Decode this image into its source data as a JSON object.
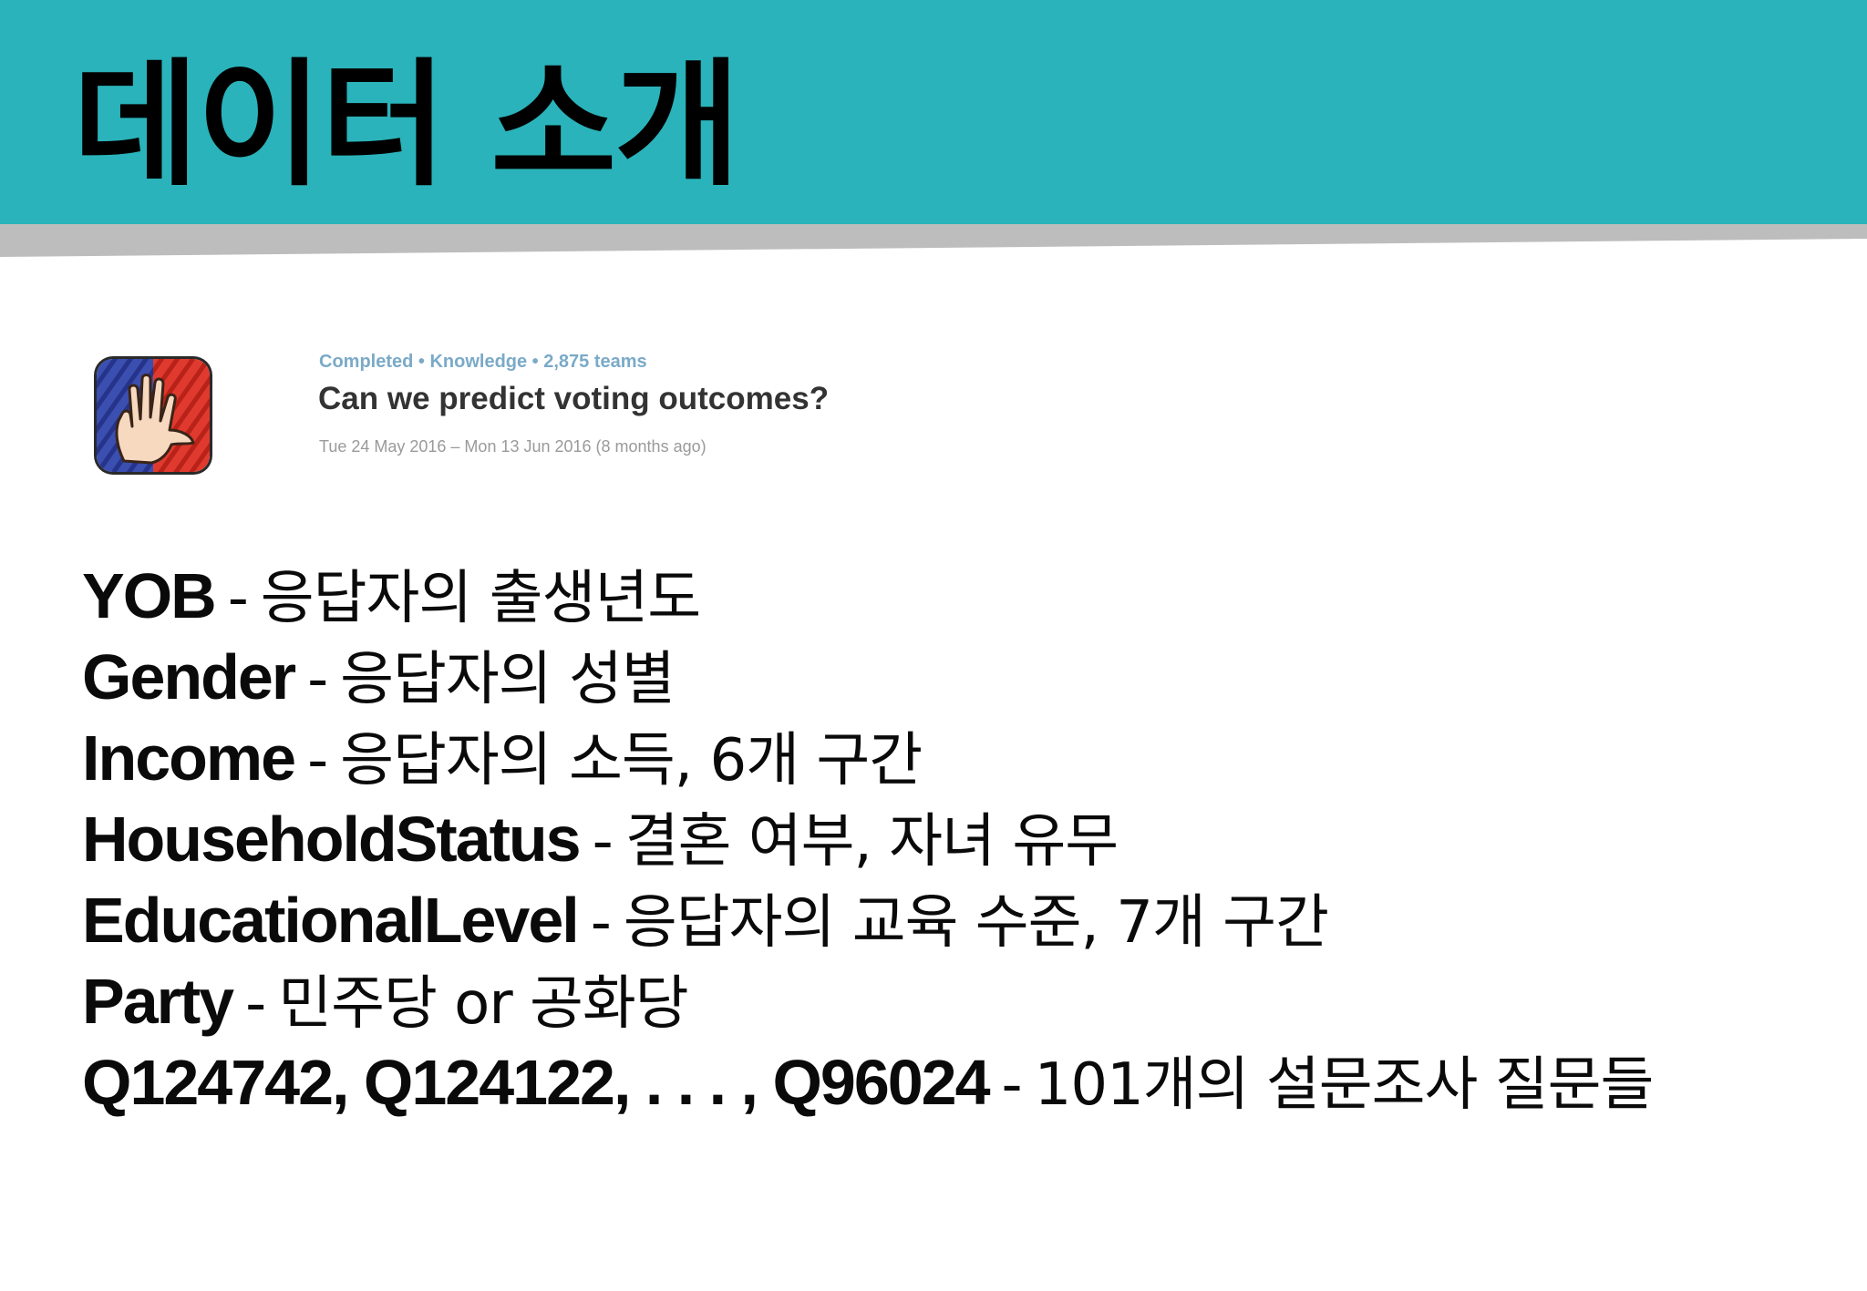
{
  "slide": {
    "title": "데이터 소개",
    "colors": {
      "header": "#2ab3ba",
      "header_shadow": "#bdbdbd",
      "meta_text": "#7aaac8"
    }
  },
  "competition": {
    "logo_icon": "raised-hand-flag-icon",
    "meta": "Completed • Knowledge • 2,875 teams",
    "title": "Can we predict voting outcomes?",
    "dates": "Tue 24 May 2016 – Mon 13 Jun 2016 (8 months ago)"
  },
  "variables": [
    {
      "name": "YOB",
      "sep": "-",
      "desc": "응답자의 출생년도"
    },
    {
      "name": "Gender",
      "sep": "-",
      "desc": "응답자의 성별"
    },
    {
      "name": "Income",
      "sep": "-",
      "desc": "응답자의 소득, 6개 구간"
    },
    {
      "name": "HouseholdStatus",
      "sep": "-",
      "desc": "결혼 여부, 자녀 유무"
    },
    {
      "name": "EducationalLevel",
      "sep": "-",
      "desc": "응답자의 교육 수준, 7개 구간"
    },
    {
      "name": "Party",
      "sep": "-",
      "desc": "민주당 or 공화당"
    },
    {
      "name": "Q124742, Q124122, . . . , Q96024",
      "sep": "-",
      "desc": "101개의 설문조사 질문들"
    }
  ]
}
